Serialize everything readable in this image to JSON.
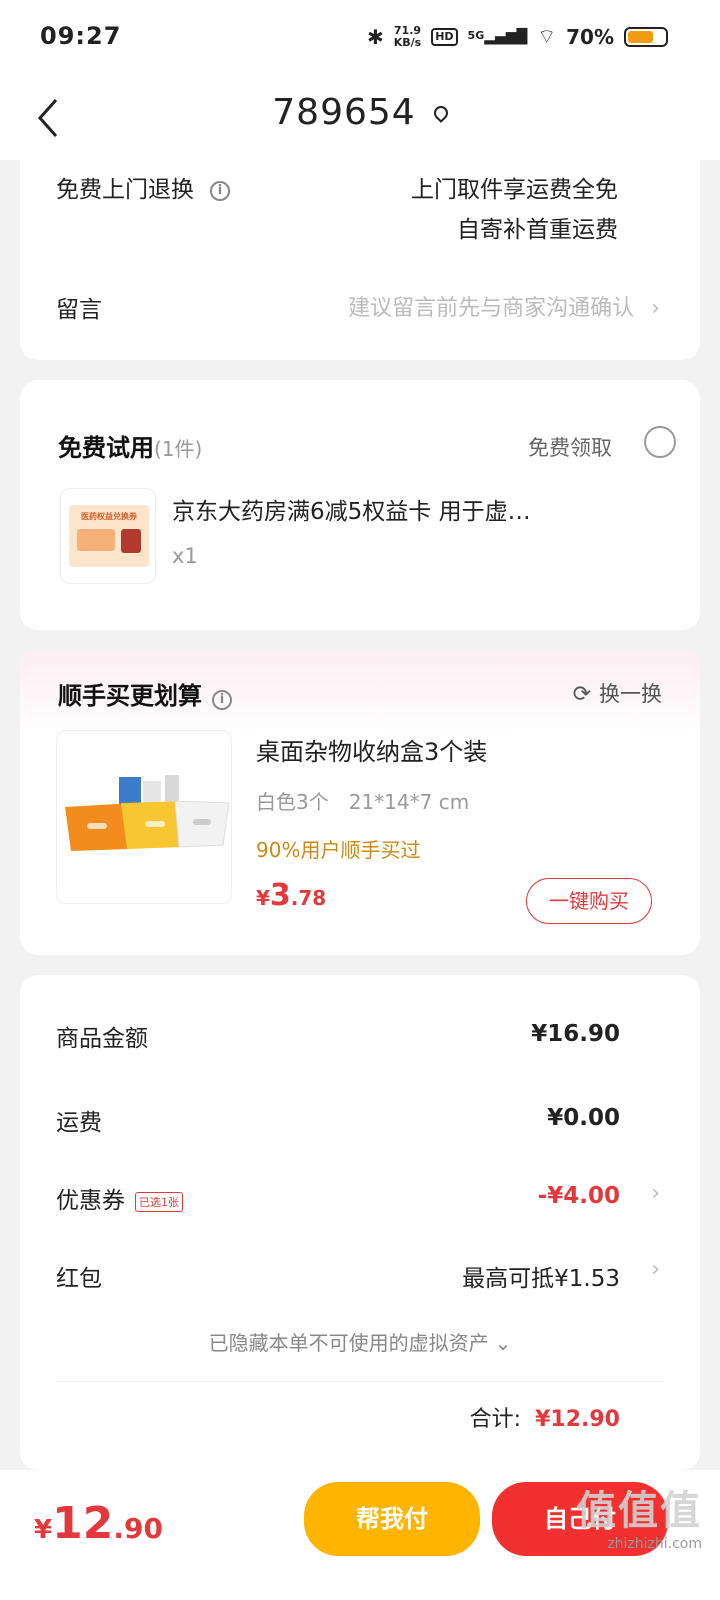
{
  "status_bar": {
    "time": "09:27",
    "net_speed": "71.9",
    "net_unit": "KB/s",
    "hd": "HD",
    "signal": "5G",
    "battery": "70%",
    "battery_level": 0.7
  },
  "nav": {
    "title": "789654"
  },
  "return_card": {
    "label": "免费上门退换",
    "line1": "上门取件享运费全免",
    "line2": "自寄补首重运费",
    "message_label": "留言",
    "message_placeholder": "建议留言前先与商家沟通确认"
  },
  "free_trial": {
    "title": "免费试用",
    "count": "(1件)",
    "claim_label": "免费领取",
    "item_title": "京东大药房满6减5权益卡 用于虚…",
    "item_qty": "x1",
    "thumb_text": "医药权益兑换券"
  },
  "buy_together": {
    "title": "顺手买更划算",
    "refresh_label": "换一换",
    "product_title": "桌面杂物收纳盒3个装",
    "product_spec": "白色3个　21*14*7 cm",
    "product_hint": "90%用户顺手买过",
    "price_symbol": "¥",
    "price_int": "3",
    "price_dec": ".78",
    "buy_label": "一键购买"
  },
  "summary": {
    "goods_label": "商品金额",
    "goods_value": "¥16.90",
    "shipping_label": "运费",
    "shipping_value": "¥0.00",
    "coupon_label": "优惠券",
    "coupon_badge": "已选1张",
    "coupon_value": "-¥4.00",
    "redpacket_label": "红包",
    "redpacket_value": "最高可抵¥1.53",
    "hidden_assets": "已隐藏本单不可使用的虚拟资产",
    "total_label": "合计:",
    "total_value": "¥12.90"
  },
  "bottom": {
    "price_symbol": "¥",
    "price_int": "12",
    "price_dec": ".90",
    "help_pay_label": "帮我付",
    "self_pay_label": "自己付",
    "watermark": "值值值",
    "watermark_url": "zhizhizhi.com"
  },
  "colors": {
    "accent_red": "#e4393c",
    "gold": "#c98a14",
    "help_pay": "#ffb400",
    "self_pay": "#f23030"
  }
}
